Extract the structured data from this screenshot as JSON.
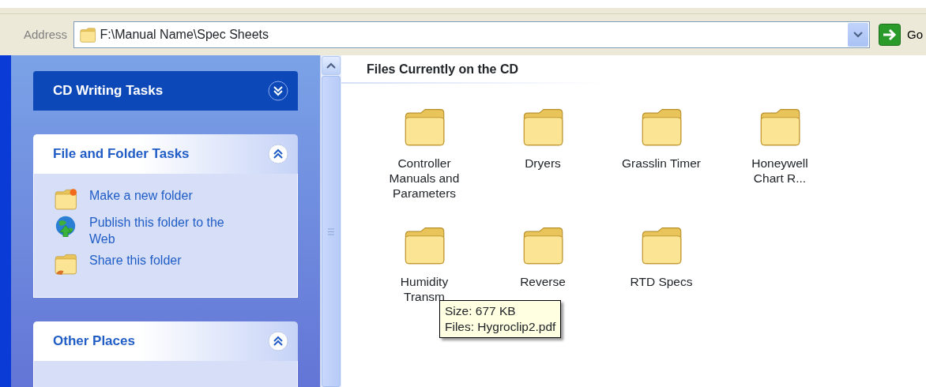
{
  "address_bar": {
    "label": "Address",
    "value": "F:\\Manual Name\\Spec Sheets",
    "go_label": "Go"
  },
  "sidebar": {
    "panels": [
      {
        "title": "CD Writing Tasks",
        "kind": "special",
        "expanded": false
      },
      {
        "title": "File and Folder Tasks",
        "kind": "normal",
        "expanded": true,
        "items": [
          {
            "label": "Make a new folder",
            "kind": "new-folder"
          },
          {
            "label": "Publish this folder to the Web",
            "kind": "publish"
          },
          {
            "label": "Share this folder",
            "kind": "share"
          }
        ]
      },
      {
        "title": "Other Places",
        "kind": "normal",
        "expanded": true
      }
    ]
  },
  "content": {
    "title": "Files Currently on the CD",
    "folders": [
      {
        "label": "Controller Manuals and Parameters"
      },
      {
        "label": "Dryers"
      },
      {
        "label": "Grasslin Timer"
      },
      {
        "label": "Honeywell Chart R..."
      },
      {
        "label": "Humidity Transm"
      },
      {
        "label": "Reverse"
      },
      {
        "label": "RTD Specs"
      }
    ]
  },
  "tooltip": {
    "lines": [
      "Size: 677 KB",
      "Files: Hygroclip2.pdf"
    ]
  }
}
